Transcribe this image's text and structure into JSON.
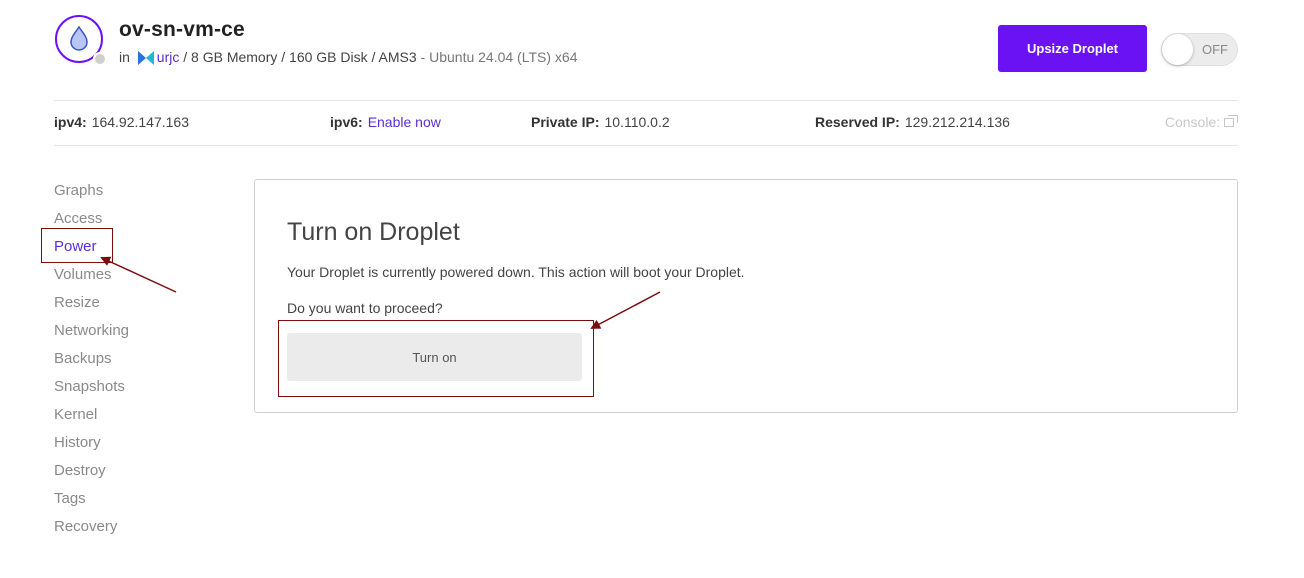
{
  "header": {
    "droplet_name": "ov-sn-vm-ce",
    "in_label": "in",
    "project": "urjc",
    "specs": " / 8 GB Memory / 160 GB Disk / AMS3",
    "os": " - Ubuntu 24.04 (LTS) x64",
    "upsize_button": "Upsize Droplet",
    "power_toggle": "OFF",
    "status": "off"
  },
  "ip_bar": {
    "ipv4_label": "ipv4:",
    "ipv4_value": "164.92.147.163",
    "ipv6_label": "ipv6:",
    "ipv6_link": "Enable now",
    "private_label": "Private IP:",
    "private_value": "10.110.0.2",
    "reserved_label": "Reserved IP:",
    "reserved_value": "129.212.214.136",
    "console_label": "Console:"
  },
  "sidebar": {
    "active": "Power",
    "items": [
      {
        "label": "Graphs"
      },
      {
        "label": "Access"
      },
      {
        "label": "Power"
      },
      {
        "label": "Volumes"
      },
      {
        "label": "Resize"
      },
      {
        "label": "Networking"
      },
      {
        "label": "Backups"
      },
      {
        "label": "Snapshots"
      },
      {
        "label": "Kernel"
      },
      {
        "label": "History"
      },
      {
        "label": "Destroy"
      },
      {
        "label": "Tags"
      },
      {
        "label": "Recovery"
      }
    ]
  },
  "power_panel": {
    "title": "Turn on Droplet",
    "description": "Your Droplet is currently powered down. This action will boot your Droplet.",
    "question": "Do you want to proceed?",
    "button": "Turn on"
  },
  "colors": {
    "accent": "#6b12f5",
    "link": "#5b2cd6",
    "annotation": "#7a0d0d"
  },
  "icons": [
    "droplet-icon",
    "project-icon",
    "console-popout-icon"
  ]
}
